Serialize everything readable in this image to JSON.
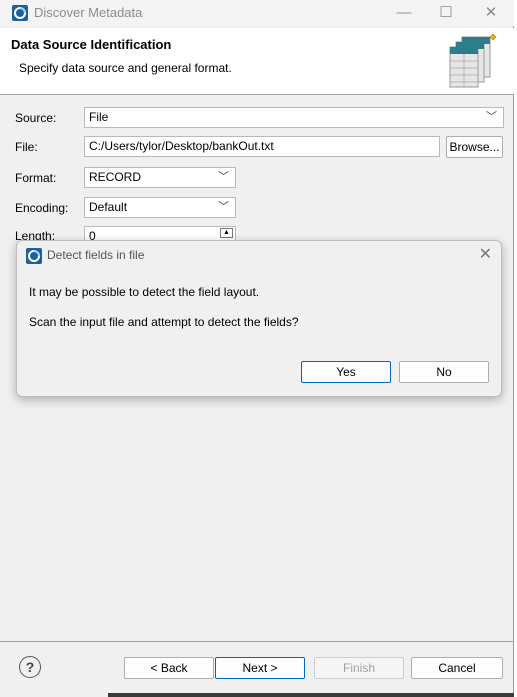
{
  "window": {
    "title": "Discover Metadata",
    "minimize_label": "—",
    "maximize_label": "☐",
    "close_label": "✕"
  },
  "header": {
    "title": "Data Source Identification",
    "description": "Specify data source and general format."
  },
  "form": {
    "source_label": "Source:",
    "source_value": "File",
    "file_label": "File:",
    "file_value": "C:/Users/tylor/Desktop/bankOut.txt",
    "browse_label": "Browse...",
    "format_label": "Format:",
    "format_value": "RECORD",
    "encoding_label": "Encoding:",
    "encoding_value": "Default",
    "length_label": "Length:",
    "length_value": "0"
  },
  "dialog": {
    "title": "Detect fields in file",
    "close_label": "✕",
    "message_1": "It may be possible to detect the field layout.",
    "message_2": "Scan the input file and attempt to detect the fields?",
    "yes_label": "Yes",
    "no_label": "No"
  },
  "footer": {
    "help_label": "?",
    "back_label": "< Back",
    "next_label": "Next >",
    "finish_label": "Finish",
    "cancel_label": "Cancel"
  },
  "colors": {
    "accent": "#0067c0",
    "icon_teal": "#2e7d8c"
  }
}
